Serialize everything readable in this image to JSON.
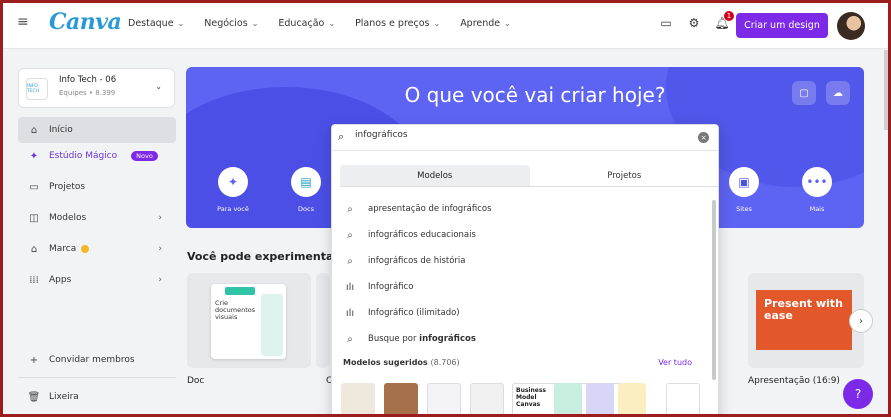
{
  "topbar": {
    "logo": "Canva",
    "nav": [
      {
        "label": "Destaque"
      },
      {
        "label": "Negócios"
      },
      {
        "label": "Educação"
      },
      {
        "label": "Planos e preços"
      },
      {
        "label": "Aprende"
      }
    ],
    "notifications_count": "1",
    "create_button": "Criar um design"
  },
  "sidebar": {
    "team_logo": "INFO TECH",
    "team_name": "Info Tech - 06",
    "team_sub": "Equipes • 8.399",
    "items": [
      {
        "label": "Início"
      },
      {
        "label": "Estúdio Mágico",
        "badge": "Novo"
      },
      {
        "label": "Projetos"
      },
      {
        "label": "Modelos"
      },
      {
        "label": "Marca"
      },
      {
        "label": "Apps"
      }
    ],
    "invite": "Convidar membros",
    "trash": "Lixeira"
  },
  "hero": {
    "title": "O que você vai criar hoje?",
    "categories": [
      {
        "label": "Para você"
      },
      {
        "label": "Docs"
      },
      {
        "label": "Sites"
      },
      {
        "label": "Mais"
      }
    ]
  },
  "main": {
    "section_title": "Você pode experimentar...",
    "cards": [
      {
        "label": "Doc"
      },
      {
        "label": "C"
      },
      {
        "label": "Apresentação (16:9)"
      }
    ],
    "doc_preview": "Crie documentos visuais",
    "present_preview": "Present with ease"
  },
  "search": {
    "value": "infográficos",
    "tabs": [
      {
        "label": "Modelos",
        "active": true
      },
      {
        "label": "Projetos",
        "active": false
      }
    ],
    "suggestions": [
      {
        "icon": "search-icon",
        "text": "apresentação de infográficos"
      },
      {
        "icon": "search-icon",
        "text": "infográficos educacionais"
      },
      {
        "icon": "search-icon",
        "text": "infográficos de história"
      },
      {
        "icon": "chart-icon",
        "text": "Infográfico"
      },
      {
        "icon": "chart-icon",
        "text": "Infográfico (ilimitado)"
      },
      {
        "icon": "search-icon",
        "text_prefix": "Busque por",
        "text_bold": "infográficos"
      }
    ],
    "models_heading": "Modelos sugeridos",
    "models_count": "(8.706)",
    "see_all": "Ver tudo",
    "thumb_text": "Business Model Canvas"
  },
  "colors": {
    "accent": "#7d2ae8",
    "hero": "#5d63f3",
    "frame": "#9b1d1d"
  }
}
